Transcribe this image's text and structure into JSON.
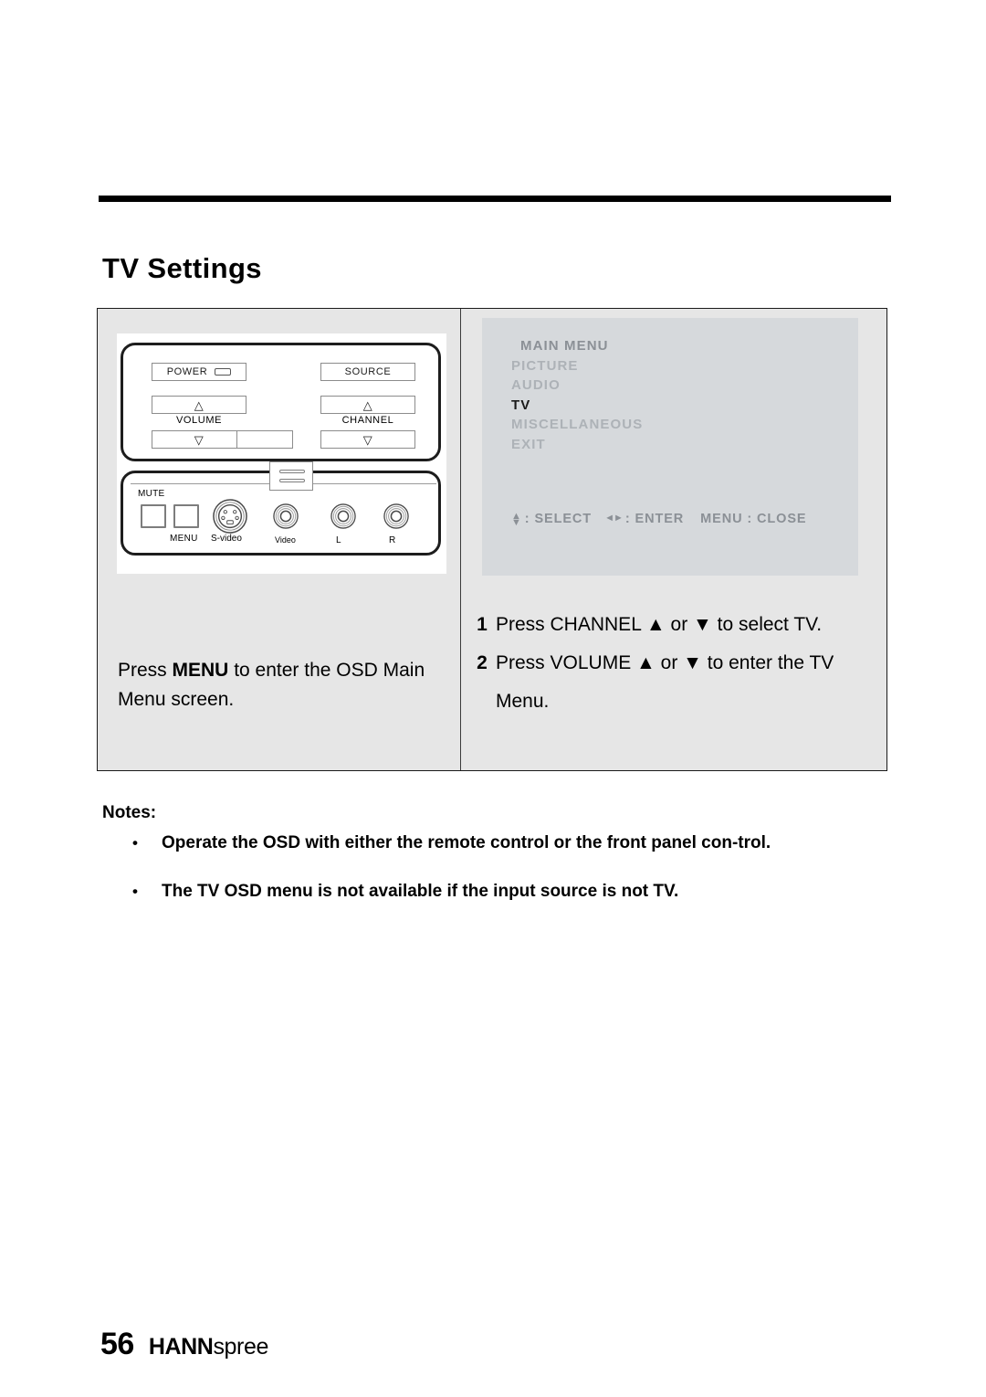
{
  "page": {
    "title": "TV Settings",
    "page_number": "56",
    "brand_bold": "HANN",
    "brand_light": "spree"
  },
  "panel_diagram": {
    "power_label": "POWER",
    "source_label": "SOURCE",
    "volume_label": "VOLUME",
    "channel_label": "CHANNEL",
    "up_glyph": "△",
    "down_glyph": "▽",
    "mute_label": "MUTE",
    "menu_label": "MENU",
    "svideo_label": "S-video",
    "video_label": "Video",
    "left_label": "L",
    "right_label": "R"
  },
  "osd": {
    "items": [
      {
        "label": "MAIN MENU",
        "state": "title"
      },
      {
        "label": "PICTURE",
        "state": "normal"
      },
      {
        "label": "AUDIO",
        "state": "normal"
      },
      {
        "label": "TV",
        "state": "active"
      },
      {
        "label": "MISCELLANEOUS",
        "state": "normal"
      },
      {
        "label": "EXIT",
        "state": "normal"
      }
    ],
    "statusbar": {
      "updown_arrows": "▲▼",
      "select": ": SELECT",
      "leftright_arrows": "◄►",
      "enter": ": ENTER",
      "close": "MENU : CLOSE"
    },
    "colors": {
      "screen_bg": "#d6d9dc",
      "dim_text": "#adb2b7",
      "title_text": "#8b9096",
      "active_text": "#1a1a1a"
    }
  },
  "left_instruction": {
    "part1": "Press ",
    "bold": "MENU",
    "part2": " to enter the OSD Main Menu screen."
  },
  "steps": [
    {
      "num": "1",
      "text": "Press CHANNEL ▲ or ▼ to select TV."
    },
    {
      "num": "2",
      "text": "Press VOLUME ▲ or ▼ to enter the TV Menu."
    }
  ],
  "notes": {
    "heading": "Notes:",
    "bullet": "•",
    "items": [
      "Operate the OSD with either the remote control or the front panel con-trol.",
      "The TV OSD menu is not available if the input source is not TV."
    ]
  }
}
